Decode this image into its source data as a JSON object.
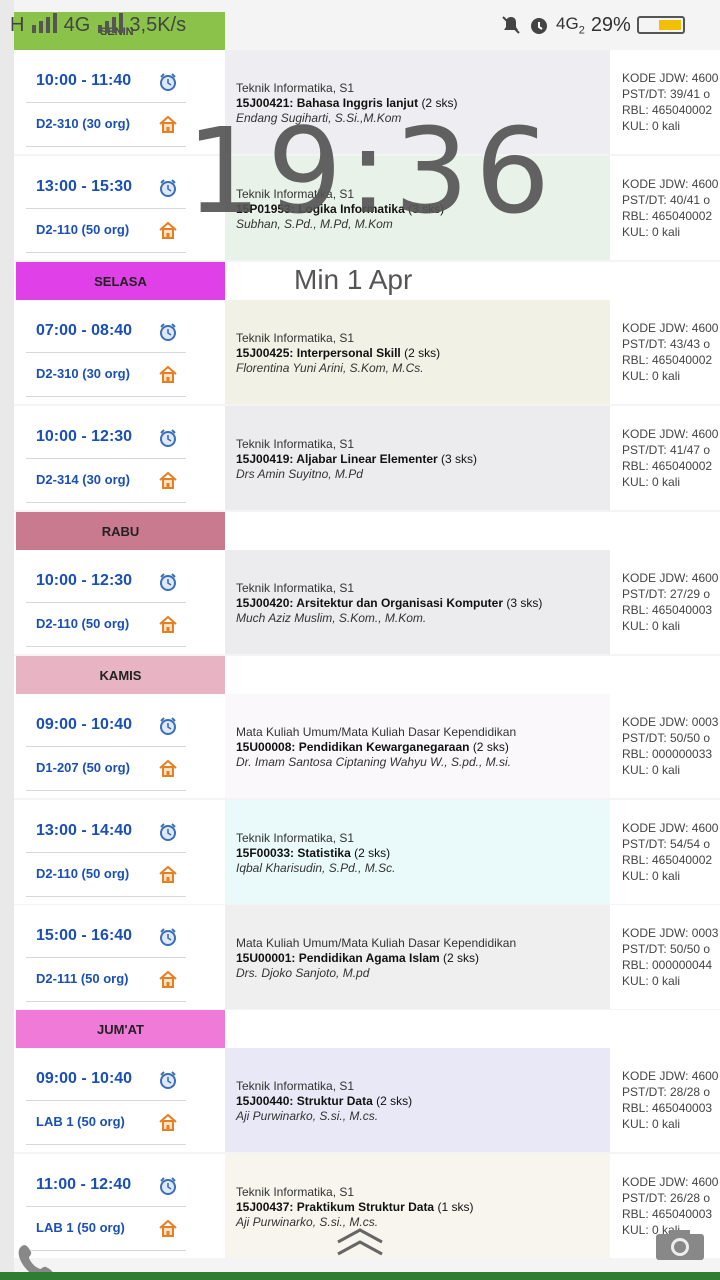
{
  "status_bar": {
    "network": "H",
    "net2": "4G",
    "speed": "3,5K/s",
    "net3": "4G",
    "sim": "2",
    "battery": "29%"
  },
  "lock_overlay": {
    "time": "19:36",
    "date": "Min 1 Apr"
  },
  "colors": {
    "senin": "#8bc34a",
    "selasa": "#e040e8",
    "rabu": "#c97a8e",
    "kamis": "#e8b4c4",
    "jumat": "#f07ad8",
    "time_text": "#1a4fb6"
  },
  "days": [
    {
      "label": "SENIN"
    },
    {
      "label": "SELASA"
    },
    {
      "label": "RABU"
    },
    {
      "label": "KAMIS"
    },
    {
      "label": "JUM'AT"
    }
  ],
  "entries": [
    {
      "time": "10:00 - 11:40",
      "room": "D2-310 (30 org)",
      "program": "Teknik Informatika, S1",
      "code": "15J00421:",
      "course": "Bahasa Inggris lanjut",
      "sks": "(2 sks)",
      "lecturer": "Endang Sugiharti, S.Si.,M.Kom",
      "kode": "KODE JDW: 4600",
      "pst": "PST/DT: 39/41 o",
      "rbl": "RBL: 465040002",
      "kul": "KUL: 0 kali"
    },
    {
      "time": "13:00 - 15:30",
      "room": "D2-110 (50 org)",
      "program": "Teknik Informatika, S1",
      "code": "15P01953:",
      "course": "Logika Informatika",
      "sks": "(3 sks)",
      "lecturer": "Subhan, S.Pd., M.Pd, M.Kom",
      "kode": "KODE JDW: 4600",
      "pst": "PST/DT: 40/41 o",
      "rbl": "RBL: 465040002",
      "kul": "KUL: 0 kali"
    },
    {
      "time": "07:00 - 08:40",
      "room": "D2-310 (30 org)",
      "program": "Teknik Informatika, S1",
      "code": "15J00425:",
      "course": "Interpersonal Skill",
      "sks": "(2 sks)",
      "lecturer": "Florentina Yuni Arini, S.Kom, M.Cs.",
      "kode": "KODE JDW: 4600",
      "pst": "PST/DT: 43/43 o",
      "rbl": "RBL: 465040002",
      "kul": "KUL: 0 kali"
    },
    {
      "time": "10:00 - 12:30",
      "room": "D2-314 (30 org)",
      "program": "Teknik Informatika, S1",
      "code": "15J00419:",
      "course": "Aljabar Linear Elementer",
      "sks": "(3 sks)",
      "lecturer": "Drs Amin Suyitno, M.Pd",
      "kode": "KODE JDW: 4600",
      "pst": "PST/DT: 41/47 o",
      "rbl": "RBL: 465040002",
      "kul": "KUL: 0 kali"
    },
    {
      "time": "10:00 - 12:30",
      "room": "D2-110 (50 org)",
      "program": "Teknik Informatika, S1",
      "code": "15J00420:",
      "course": "Arsitektur dan Organisasi Komputer",
      "sks": "(3 sks)",
      "lecturer": "Much Aziz Muslim, S.Kom., M.Kom.",
      "kode": "KODE JDW: 4600",
      "pst": "PST/DT: 27/29 o",
      "rbl": "RBL: 465040003",
      "kul": "KUL: 0 kali"
    },
    {
      "time": "09:00 - 10:40",
      "room": "D1-207 (50 org)",
      "program": "Mata Kuliah Umum/Mata Kuliah Dasar Kependidikan",
      "code": "15U00008:",
      "course": "Pendidikan Kewarganegaraan",
      "sks": "(2 sks)",
      "lecturer": "Dr. Imam Santosa Ciptaning Wahyu W., S.pd., M.si.",
      "kode": "KODE JDW: 0003",
      "pst": "PST/DT: 50/50 o",
      "rbl": "RBL: 000000033",
      "kul": "KUL: 0 kali"
    },
    {
      "time": "13:00 - 14:40",
      "room": "D2-110 (50 org)",
      "program": "Teknik Informatika, S1",
      "code": "15F00033:",
      "course": "Statistika",
      "sks": "(2 sks)",
      "lecturer": "Iqbal Kharisudin, S.Pd., M.Sc.",
      "kode": "KODE JDW: 4600",
      "pst": "PST/DT: 54/54 o",
      "rbl": "RBL: 465040002",
      "kul": "KUL: 0 kali"
    },
    {
      "time": "15:00 - 16:40",
      "room": "D2-111 (50 org)",
      "program": "Mata Kuliah Umum/Mata Kuliah Dasar Kependidikan",
      "code": "15U00001:",
      "course": "Pendidikan Agama Islam",
      "sks": "(2 sks)",
      "lecturer": "Drs. Djoko Sanjoto, M.pd",
      "kode": "KODE JDW: 0003",
      "pst": "PST/DT: 50/50 o",
      "rbl": "RBL: 000000044",
      "kul": "KUL: 0 kali"
    },
    {
      "time": "09:00 - 10:40",
      "room": "LAB 1 (50 org)",
      "program": "Teknik Informatika, S1",
      "code": "15J00440:",
      "course": "Struktur Data",
      "sks": "(2 sks)",
      "lecturer": "Aji Purwinarko, S.si., M.cs.",
      "kode": "KODE JDW: 4600",
      "pst": "PST/DT: 28/28 o",
      "rbl": "RBL: 465040003",
      "kul": "KUL: 0 kali"
    },
    {
      "time": "11:00 - 12:40",
      "room": "LAB 1 (50 org)",
      "program": "Teknik Informatika, S1",
      "code": "15J00437:",
      "course": "Praktikum Struktur Data",
      "sks": "(1 sks)",
      "lecturer": "Aji Purwinarko, S.si., M.cs.",
      "kode": "KODE JDW: 4600",
      "pst": "PST/DT: 26/28 o",
      "rbl": "RBL: 465040003",
      "kul": "KUL: 0 kali"
    }
  ]
}
